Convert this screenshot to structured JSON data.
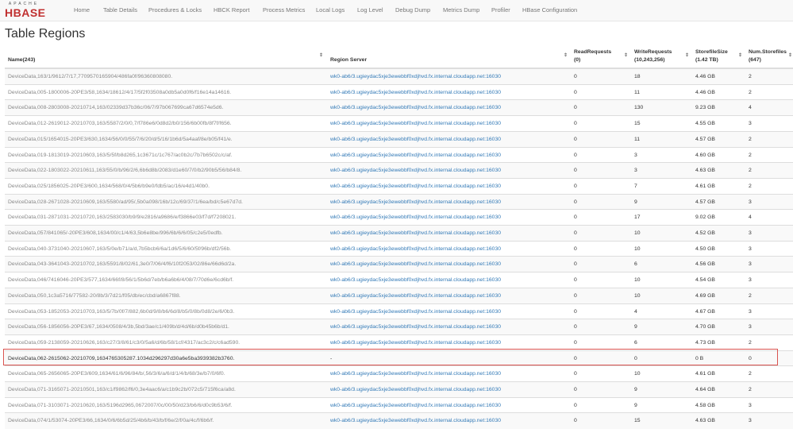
{
  "logo": {
    "line1": "APACHE",
    "line2": "HBASE"
  },
  "nav": [
    {
      "label": "Home"
    },
    {
      "label": "Table Details"
    },
    {
      "label": "Procedures & Locks"
    },
    {
      "label": "HBCK Report"
    },
    {
      "label": "Process Metrics"
    },
    {
      "label": "Local Logs"
    },
    {
      "label": "Log Level"
    },
    {
      "label": "Debug Dump"
    },
    {
      "label": "Metrics Dump"
    },
    {
      "label": "Profiler"
    },
    {
      "label": "HBase Configuration"
    }
  ],
  "page_title": "Table Regions",
  "table": {
    "headers": {
      "name": "Name(243)",
      "server": "Region Server",
      "read_1": "ReadRequests",
      "read_2": "(0)",
      "write_1": "WriteRequests",
      "write_2": "(10,243,256)",
      "size_1": "StorefileSize",
      "size_2": "(1.42 TB)",
      "num_1": "Num.Storefiles",
      "num_2": "(647)"
    },
    "sort_icon": "⇕",
    "rows": [
      {
        "name": "DeviceData,163/1/9612/7/17,7709570165904/486fa0f/96360808080.",
        "server": "wk0-ab6/3.ugieydac5xje3ewebbf0xdjhvd.fx.internal.cloudapp.net:16030",
        "read": "0",
        "write": "18",
        "size": "4.46 GB",
        "num": "2"
      },
      {
        "name": "DeviceData,005-1800006-20PE3/58,1634/18612/4/17/5f2f03508a0db5a0d0f6/f16e14a14616.",
        "server": "wk0-ab6/3.ugieydac5xje3ewebbf0xdjhvd.fx.internal.cloudapp.net:16030",
        "read": "0",
        "write": "11",
        "size": "4.46 GB",
        "num": "2"
      },
      {
        "name": "DeviceData,008-2803008-20210714,163/02339d37b36c/06/7/97b067699ca67d6574e5d6.",
        "server": "wk0-ab6/3.ugieydac5xje3ewebbf0xdjhvd.fx.internal.cloudapp.net:16030",
        "read": "0",
        "write": "130",
        "size": "9.23 GB",
        "num": "4"
      },
      {
        "name": "DeviceData,012-2619012-20210703,163/5587/2/0/0,7/f786e6/0d8d2/b0/156/6b00fb/8f7f/f656.",
        "server": "wk0-ab6/3.ugieydac5xje3ewebbf0xdjhvd.fx.internal.cloudapp.net:16030",
        "read": "0",
        "write": "15",
        "size": "4.55 GB",
        "num": "3"
      },
      {
        "name": "DeviceData,015/1654015-20PE3/630,1634/56/0/0/55/7/6/20/d/5/16/1b6d/5a4aaf/8e/b05/f41/e.",
        "server": "wk0-ab6/3.ugieydac5xje3ewebbf0xdjhvd.fx.internal.cloudapp.net:16030",
        "read": "0",
        "write": "11",
        "size": "4.57 GB",
        "num": "2"
      },
      {
        "name": "DeviceData,019-1813019-20210603,163/5/5f/b8d265,1c3671c/1c767/ac0b2c/7b7b6502c/c/af.",
        "server": "wk0-ab6/3.ugieydac5xje3ewebbf0xdjhvd.fx.internal.cloudapp.net:16030",
        "read": "0",
        "write": "3",
        "size": "4.60 GB",
        "num": "2"
      },
      {
        "name": "DeviceData,022-1803022-20210611,163/55/0/b/96/2/6,6b6d8b/2083/d1e60/7/0/b2/90b5/56/b84/8.",
        "server": "wk0-ab6/3.ugieydac5xje3ewebbf0xdjhvd.fx.internal.cloudapp.net:16030",
        "read": "0",
        "write": "3",
        "size": "4.63 GB",
        "num": "2"
      },
      {
        "name": "DeviceData,025/1856025-20PE3/600,1634/568/0/4/5b6/b9e0/fdb5/ac/16/e4d1/40b0.",
        "server": "wk0-ab6/3.ugieydac5xje3ewebbf0xdjhvd.fx.internal.cloudapp.net:16030",
        "read": "0",
        "write": "7",
        "size": "4.61 GB",
        "num": "2"
      },
      {
        "name": "DeviceData,028-2671028-20210609,163/5580/ad/95/,5b0a098/16b/12c/69/37/1/6ea/bd/c5e67d7d.",
        "server": "wk0-ab6/3.ugieydac5xje3ewebbf0xdjhvd.fx.internal.cloudapp.net:16030",
        "read": "0",
        "write": "9",
        "size": "4.57 GB",
        "num": "3"
      },
      {
        "name": "DeviceData,031-2871031-20210720,163/2583030/b9/9/e2816/a9686/e/f3866e03/f7d/f7208021.",
        "server": "wk0-ab6/3.ugieydac5xje3ewebbf0xdjhvd.fx.internal.cloudapp.net:16030",
        "read": "0",
        "write": "17",
        "size": "9.02 GB",
        "num": "4"
      },
      {
        "name": "DeviceData,057/841065/-20PE3/608,1634/00/c1/4/63,5b6e8be/996/6b/6/6/05/c2e5/0edfb.",
        "server": "wk0-ab6/3.ugieydac5xje3ewebbf0xdjhvd.fx.internal.cloudapp.net:16030",
        "read": "0",
        "write": "10",
        "size": "4.52 GB",
        "num": "3"
      },
      {
        "name": "DeviceData,040-3731040-20210607,163/5/0e/b71/a/d,7b5bcb6/6a/1d6/5/6/60/5f/96b/df2/56b.",
        "server": "wk0-ab6/3.ugieydac5xje3ewebbf0xdjhvd.fx.internal.cloudapp.net:16030",
        "read": "0",
        "write": "10",
        "size": "4.50 GB",
        "num": "3"
      },
      {
        "name": "DeviceData,043-3641043-20210702,163/5591/8/02/61,3e0/7/06/4/f6/10f2053/02/86e/66d6d/2a.",
        "server": "wk0-ab6/3.ugieydac5xje3ewebbf0xdjhvd.fx.internal.cloudapp.net:16030",
        "read": "0",
        "write": "6",
        "size": "4.56 GB",
        "num": "3"
      },
      {
        "name": "DeviceData,046/7416046-20PE3/577,1634/66f/8/56/1/5b6d/7eb/b6a6b6/4/08/7/70d6e/6cd6b/f.",
        "server": "wk0-ab6/3.ugieydac5xje3ewebbf0xdjhvd.fx.internal.cloudapp.net:16030",
        "read": "0",
        "write": "10",
        "size": "4.54 GB",
        "num": "3"
      },
      {
        "name": "DeviceData,050,1c3a5716/77582-20/8b/3/7d21/f05/db/ec/cbd/a6867f88.",
        "server": "wk0-ab6/3.ugieydac5xje3ewebbf0xdjhvd.fx.internal.cloudapp.net:16030",
        "read": "0",
        "write": "10",
        "size": "4.69 GB",
        "num": "2"
      },
      {
        "name": "DeviceData,053-1852053-20210703,163/5/7b/0f/7/882,6b0d/9/8/b6/6d/8/b5/0/8b/0d8/2e/6/0b3.",
        "server": "wk0-ab6/3.ugieydac5xje3ewebbf0xdjhvd.fx.internal.cloudapp.net:16030",
        "read": "0",
        "write": "4",
        "size": "4.67 GB",
        "num": "3"
      },
      {
        "name": "DeviceData,056-1856056-20PE3/67,1634/0508/4/3b,5bd/3ae/c1/409b/d/4d/6b/d0b45b6b/d1.",
        "server": "wk0-ab6/3.ugieydac5xje3ewebbf0xdjhvd.fx.internal.cloudapp.net:16030",
        "read": "0",
        "write": "9",
        "size": "4.70 GB",
        "num": "3"
      },
      {
        "name": "DeviceData,059-2138059-20210626,163/c27/3/8/61/c3/0/5a6/d/6b/58/1cf/4317/ac3c2/c/c6ad590.",
        "server": "wk0-ab6/3.ugieydac5xje3ewebbf0xdjhvd.fx.internal.cloudapp.net:16030",
        "read": "0",
        "write": "6",
        "size": "4.73 GB",
        "num": "2"
      },
      {
        "name": "DeviceData,062-2615062-20210709,1634765305287.1034d296297d30a6e5ba3939382b3760.",
        "server": "-",
        "read": "0",
        "write": "0",
        "size": "0 B",
        "num": "0"
      },
      {
        "name": "DeviceData,065-2656065-20PE3/609,1634/61/6/96/84/b/,56/3/6/a/6/d/1/4/b/68/3e/b7/0/6f0.",
        "server": "wk0-ab6/3.ugieydac5xje3ewebbf0xdjhvd.fx.internal.cloudapp.net:16030",
        "read": "0",
        "write": "10",
        "size": "4.61 GB",
        "num": "2"
      },
      {
        "name": "DeviceData,071-3165071-20210501,163/c1/f9862/f6/0,3e4aac6/a/c1b9c2b/072c5/715f6ca/a8d.",
        "server": "wk0-ab6/3.ugieydac5xje3ewebbf0xdjhvd.fx.internal.cloudapp.net:16030",
        "read": "0",
        "write": "9",
        "size": "4.64 GB",
        "num": "2"
      },
      {
        "name": "DeviceData,071-3103071-20210620,163/5196d2965,0672007/0c/00/50/d23/b6/6/d0c9b53/6/f.",
        "server": "wk0-ab6/3.ugieydac5xje3ewebbf0xdjhvd.fx.internal.cloudapp.net:16030",
        "read": "0",
        "write": "9",
        "size": "4.58 GB",
        "num": "3"
      },
      {
        "name": "DeviceData,074/1/53074-20PE3/66,1634/0/6/6b5d/25/4b6/b/43/b/f/6e/2/f/0a/4c/f/6b6/f.",
        "server": "wk0-ab6/3.ugieydac5xje3ewebbf0xdjhvd.fx.internal.cloudapp.net:16030",
        "read": "0",
        "write": "15",
        "size": "4.63 GB",
        "num": "3"
      }
    ]
  },
  "highlight_row_index": 18,
  "colors": {
    "link": "#337ab7",
    "highlight_border": "#d9534f",
    "brand": "#c03030"
  }
}
